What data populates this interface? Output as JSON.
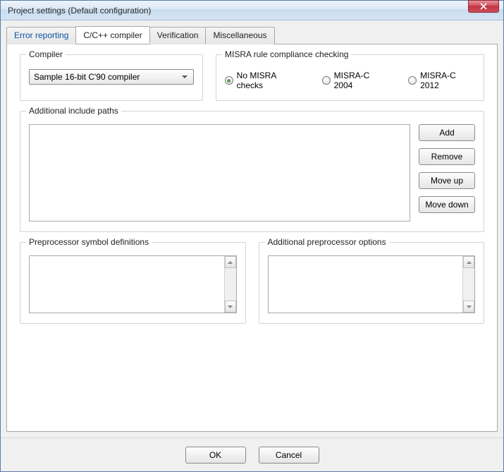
{
  "window": {
    "title": "Project settings (Default configuration)"
  },
  "tabs": {
    "error_reporting": "Error reporting",
    "cpp_compiler": "C/C++ compiler",
    "verification": "Verification",
    "miscellaneous": "Miscellaneous"
  },
  "compiler": {
    "legend": "Compiler",
    "selected": "Sample 16-bit C'90 compiler"
  },
  "misra": {
    "legend": "MISRA rule compliance checking",
    "options": {
      "none": "No MISRA checks",
      "c2004": "MISRA-C 2004",
      "c2012": "MISRA-C 2012"
    },
    "selected": "none"
  },
  "paths": {
    "legend": "Additional include paths",
    "buttons": {
      "add": "Add",
      "remove": "Remove",
      "move_up": "Move up",
      "move_down": "Move down"
    }
  },
  "preproc_defs": {
    "legend": "Preprocessor symbol definitions"
  },
  "preproc_opts": {
    "legend": "Additional preprocessor options"
  },
  "buttons": {
    "ok": "OK",
    "cancel": "Cancel"
  }
}
